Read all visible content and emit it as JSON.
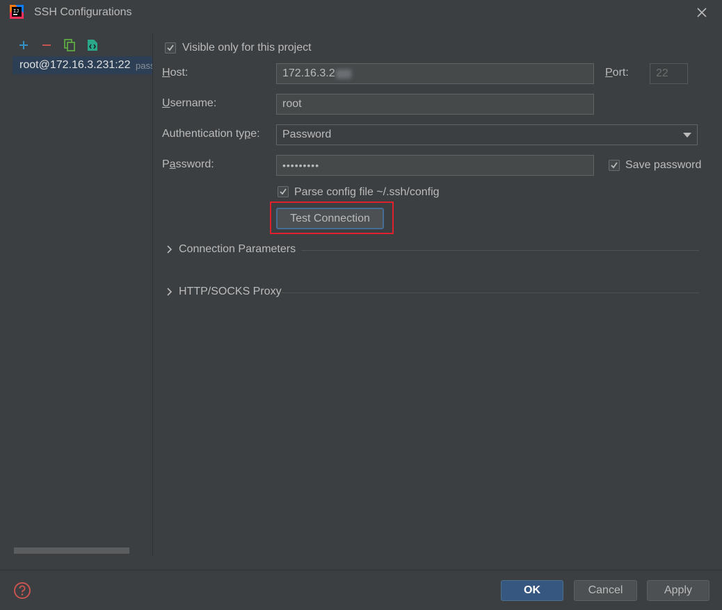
{
  "window": {
    "title": "SSH Configurations"
  },
  "colors": {
    "accent": "#365880",
    "highlight": "#e0202a",
    "error_icon": "#c75450",
    "add_icon": "#3592c4",
    "copy_icon": "#62b543"
  },
  "icons": {
    "app": "intellij-logo-icon",
    "close": "close-icon",
    "add": "plus-icon",
    "remove": "minus-icon",
    "copy": "copy-icon",
    "import": "import-file-icon",
    "help": "help-icon",
    "chevron": "chevron-right-icon",
    "dropdown": "chevron-down-icon",
    "check": "check-icon"
  },
  "left": {
    "items": [
      {
        "name": "root@172.16.3.231:22",
        "meta": "pass"
      }
    ]
  },
  "form": {
    "visible_only_label": "Visible only for this project",
    "visible_only_checked": true,
    "host_label_u": "H",
    "host_label_rest": "ost:",
    "host_value": "172.16.3.2",
    "port_label_u": "P",
    "port_label_rest": "ort:",
    "port_value": "22",
    "username_label_u": "U",
    "username_label_rest": "sername:",
    "username_value": "root",
    "auth_label_pre": "Authentication ty",
    "auth_label_u": "p",
    "auth_label_rest": "e:",
    "auth_value": "Password",
    "password_label_pre": "P",
    "password_label_u": "a",
    "password_label_rest": "ssword:",
    "password_value": "•••••••••",
    "save_password_label": "Save password",
    "save_password_checked": true,
    "parse_config_label": "Parse config file ~/.ssh/config",
    "parse_config_checked": true,
    "test_connection_label": "Test Connection"
  },
  "sections": [
    {
      "label": "Connection Parameters"
    },
    {
      "label": "HTTP/SOCKS Proxy"
    }
  ],
  "footer": {
    "ok_label": "OK",
    "cancel_label": "Cancel",
    "apply_label": "Apply"
  }
}
